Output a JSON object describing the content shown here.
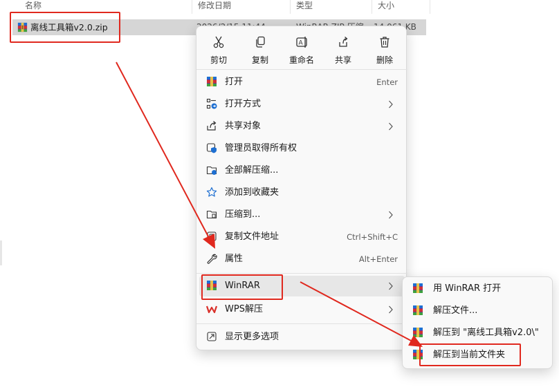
{
  "header": {
    "col_name": "名称",
    "col_date": "修改日期",
    "col_type": "类型",
    "col_size": "大小"
  },
  "file": {
    "name": "离线工具箱v2.0.zip",
    "date": "2026/2/15 11:44",
    "type": "WinRAR ZIP 压缩...",
    "size": "14,061 KB"
  },
  "quick_actions": [
    {
      "label": "剪切",
      "icon": "scissors-icon"
    },
    {
      "label": "复制",
      "icon": "copy-icon"
    },
    {
      "label": "重命名",
      "icon": "rename-icon"
    },
    {
      "label": "共享",
      "icon": "share-icon"
    },
    {
      "label": "删除",
      "icon": "trash-icon"
    }
  ],
  "menu": {
    "open": {
      "label": "打开",
      "shortcut": "Enter"
    },
    "open_with": {
      "label": "打开方式"
    },
    "share_with": {
      "label": "共享对象"
    },
    "take_ownership": {
      "label": "管理员取得所有权"
    },
    "extract_all": {
      "label": "全部解压缩..."
    },
    "add_favorites": {
      "label": "添加到收藏夹"
    },
    "compress_to": {
      "label": "压缩到..."
    },
    "copy_path": {
      "label": "复制文件地址",
      "shortcut": "Ctrl+Shift+C"
    },
    "properties": {
      "label": "属性",
      "shortcut": "Alt+Enter"
    },
    "winrar": {
      "label": "WinRAR"
    },
    "wps": {
      "label": "WPS解压"
    },
    "more_options": {
      "label": "显示更多选项"
    }
  },
  "submenu": {
    "open_with_winrar": "用 WinRAR 打开",
    "extract_files": "解压文件...",
    "extract_to_folder": "解压到 \"离线工具箱v2.0\\\"",
    "extract_here": "解压到当前文件夹"
  },
  "colors": {
    "accent_red": "#e0281e",
    "menu_bg": "#f9f9f9",
    "highlight": "#e7e7e7",
    "selection": "#d6d6d6"
  }
}
